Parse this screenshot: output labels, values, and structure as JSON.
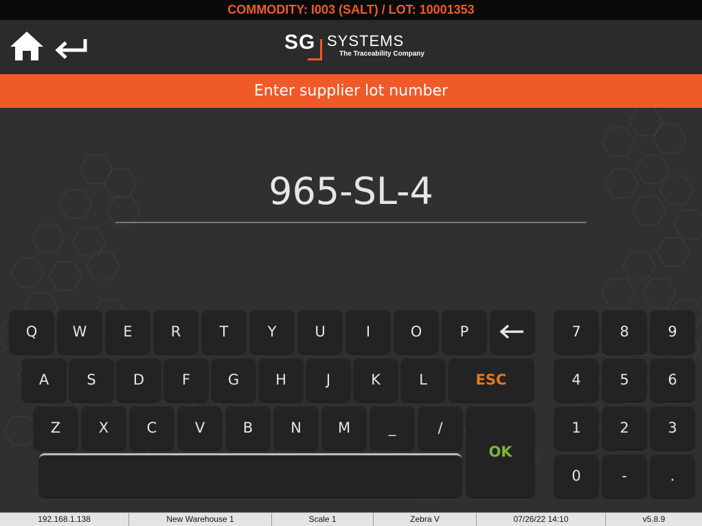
{
  "top_bar": {
    "text": "COMMODITY: I003 (SALT) / LOT: 10001353"
  },
  "header": {
    "logo": {
      "sg": "SG",
      "systems": "SYSTEMS",
      "tagline": "The Traceability Company"
    },
    "home_icon": "home-icon",
    "back_icon": "back-arrow-icon"
  },
  "prompt": {
    "text": "Enter supplier lot number"
  },
  "input": {
    "value": "965-SL-4"
  },
  "keyboard": {
    "row1": [
      "Q",
      "W",
      "E",
      "R",
      "T",
      "Y",
      "U",
      "I",
      "O",
      "P"
    ],
    "backspace_icon": "backspace-arrow-icon",
    "row2": [
      "A",
      "S",
      "D",
      "F",
      "G",
      "H",
      "J",
      "K",
      "L"
    ],
    "esc": "ESC",
    "row3": [
      "Z",
      "X",
      "C",
      "V",
      "B",
      "N",
      "M",
      "_",
      "/"
    ],
    "ok": "OK"
  },
  "numpad": {
    "row1": [
      "7",
      "8",
      "9"
    ],
    "row2": [
      "4",
      "5",
      "6"
    ],
    "row3": [
      "1",
      "2",
      "3"
    ],
    "row4": [
      "0",
      "-",
      "."
    ]
  },
  "status_bar": {
    "ip": "192.168.1.138",
    "warehouse": "New Warehouse 1",
    "scale": "Scale 1",
    "printer": "Zebra V",
    "datetime": "07/26/22 14:10",
    "version": "v5.8.9"
  },
  "colors": {
    "accent": "#f05a28",
    "esc": "#e07a1f",
    "ok": "#7db83a"
  }
}
